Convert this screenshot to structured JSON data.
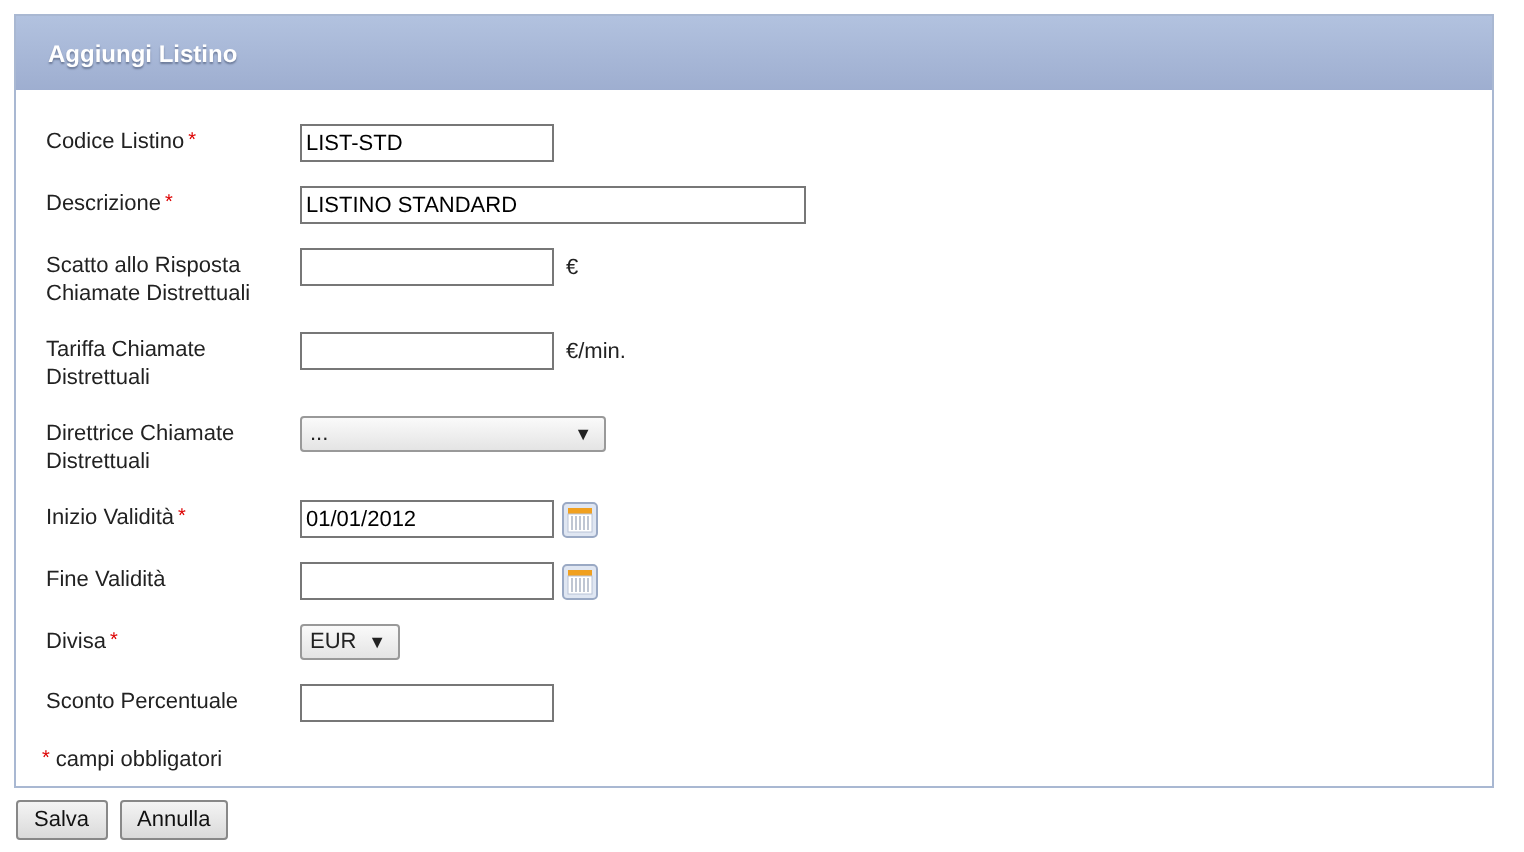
{
  "panel": {
    "title": "Aggiungi Listino"
  },
  "required_mark": "*",
  "fields": [
    {
      "kind": "text",
      "label": "Codice Listino",
      "required": true,
      "value": "LIST-STD"
    },
    {
      "kind": "wide-text",
      "label": "Descrizione",
      "required": true,
      "value": "LISTINO STANDARD"
    },
    {
      "kind": "text",
      "label": "Scatto allo Risposta Chiamate Distrettuali",
      "required": false,
      "unit": "€"
    },
    {
      "kind": "text",
      "label": "Tariffa Chiamate Distrettuali",
      "required": false,
      "unit": "€/min."
    },
    {
      "kind": "select",
      "label": "Direttrice Chiamate Distrettuali",
      "required": false,
      "value": "...",
      "arrow": "▼"
    },
    {
      "kind": "date",
      "label": "Inizio Validità",
      "required": true,
      "value": "01/01/2012"
    },
    {
      "kind": "date",
      "label": "Fine Validità",
      "required": false
    },
    {
      "kind": "small-select",
      "label": "Divisa",
      "required": true,
      "value": "EUR",
      "arrow": "▼"
    },
    {
      "kind": "text",
      "label": "Sconto Percentuale",
      "required": false
    }
  ],
  "legend": "campi obbligatori",
  "buttons": [
    "Salva",
    "Annulla"
  ]
}
